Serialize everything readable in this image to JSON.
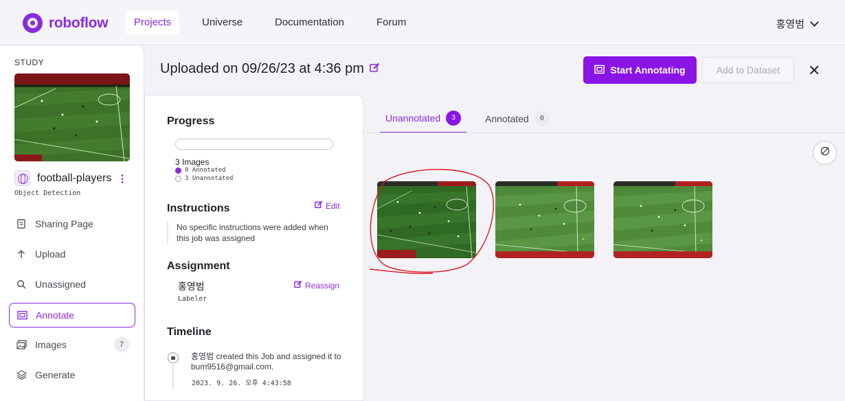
{
  "nav": {
    "brand": "roboflow",
    "items": [
      {
        "label": "Projects"
      },
      {
        "label": "Universe"
      },
      {
        "label": "Documentation"
      },
      {
        "label": "Forum"
      }
    ],
    "user": "홍영범"
  },
  "sidebar": {
    "section_label": "STUDY",
    "project_name": "football-players",
    "project_type": "Object Detection",
    "items": [
      {
        "label": "Sharing Page",
        "icon": "page-icon"
      },
      {
        "label": "Upload",
        "icon": "upload-arrow-icon"
      },
      {
        "label": "Unassigned",
        "icon": "search-icon"
      },
      {
        "label": "Annotate",
        "icon": "annotate-icon"
      },
      {
        "label": "Images",
        "icon": "images-icon",
        "count": "7"
      },
      {
        "label": "Generate",
        "icon": "layers-icon"
      }
    ]
  },
  "header": {
    "title": "Uploaded on 09/26/23 at 4:36 pm",
    "start_annotating": "Start Annotating",
    "add_to_dataset": "Add to Dataset"
  },
  "info": {
    "progress_heading": "Progress",
    "progress_fraction": 0,
    "image_count": "3 Images",
    "annotated": "0 Annotated",
    "unannotated": "3 Unannotated",
    "instructions_heading": "Instructions",
    "edit_label": "Edit",
    "instructions_text": "No specific instructions were added when this job was assigned",
    "assignment_heading": "Assignment",
    "assignee": "홍영범",
    "role": "Labeler",
    "reassign_label": "Reassign",
    "timeline_heading": "Timeline",
    "timeline_entry": "홍영범 created this Job and assigned it to bum9516@gmail.com.",
    "timeline_date": "2023. 9. 26. 오후 4:43:58"
  },
  "tabs": [
    {
      "label": "Unannotated",
      "count": "3"
    },
    {
      "label": "Annotated",
      "count": "0"
    }
  ],
  "colors": {
    "accent": "#8a2be2",
    "pitch": "#3b7a2a",
    "annotation": "#e0141e"
  }
}
